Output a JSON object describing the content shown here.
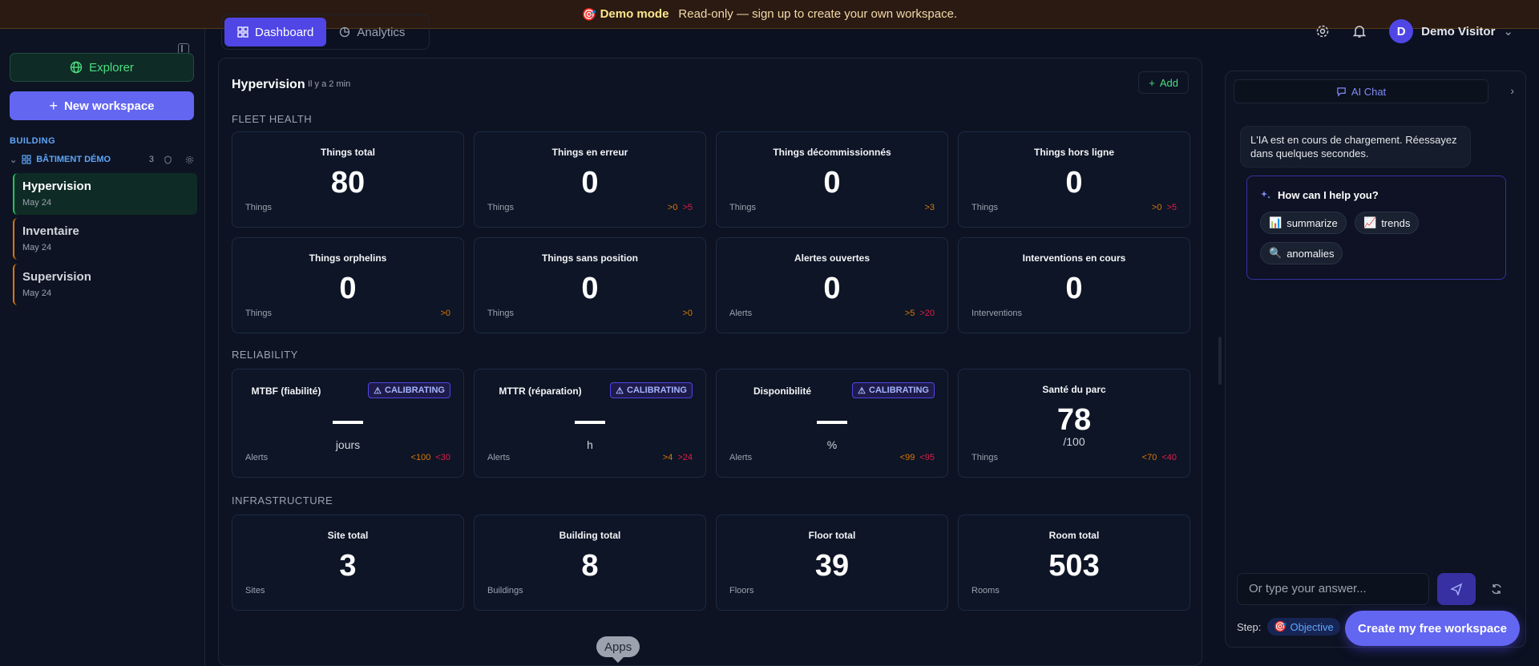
{
  "banner": {
    "icon": "🎯",
    "title": "Demo mode",
    "text": "Read-only — sign up to create your own workspace."
  },
  "sidebar": {
    "explorer_label": "Explorer",
    "new_workspace_label": "New workspace",
    "section_label": "BUILDING",
    "building": {
      "name": "BÂTIMENT DÉMO",
      "count": "3"
    },
    "workspaces": [
      {
        "name": "Hypervision",
        "date": "May 24",
        "active": true
      },
      {
        "name": "Inventaire",
        "date": "May 24"
      },
      {
        "name": "Supervision",
        "date": "May 24"
      }
    ]
  },
  "header": {
    "tabs": [
      {
        "label": "Dashboard"
      },
      {
        "label": "Analytics"
      }
    ],
    "user": {
      "initial": "D",
      "name": "Demo Visitor"
    }
  },
  "main": {
    "title": "Hypervision",
    "subtitle": "Il y a 2 min",
    "add_label": "Add",
    "fleet_label": "FLEET HEALTH",
    "reliability_label": "RELIABILITY",
    "infra_label": "INFRASTRUCTURE",
    "fleet": [
      {
        "title": "Things total",
        "value": "80",
        "unit": "Things",
        "warn": "",
        "err": ""
      },
      {
        "title": "Things en erreur",
        "value": "0",
        "unit": "Things",
        "warn": ">0",
        "err": ">5"
      },
      {
        "title": "Things décommissionnés",
        "value": "0",
        "unit": "Things",
        "warn": ">3",
        "err": ""
      },
      {
        "title": "Things hors ligne",
        "value": "0",
        "unit": "Things",
        "warn": ">0",
        "err": ">5"
      },
      {
        "title": "Things orphelins",
        "value": "0",
        "unit": "Things",
        "warn": ">0",
        "err": ""
      },
      {
        "title": "Things sans position",
        "value": "0",
        "unit": "Things",
        "warn": ">0",
        "err": ""
      },
      {
        "title": "Alertes ouvertes",
        "value": "0",
        "unit": "Alerts",
        "warn": ">5",
        "err": ">20"
      },
      {
        "title": "Interventions en cours",
        "value": "0",
        "unit": "Interventions",
        "warn": "",
        "err": ""
      }
    ],
    "reliability": [
      {
        "title": "MTBF (fiabilité)",
        "badge": "CALIBRATING",
        "unit_value": "jours",
        "unit": "Alerts",
        "warn": "<100",
        "err": "<30"
      },
      {
        "title": "MTTR (réparation)",
        "badge": "CALIBRATING",
        "unit_value": "h",
        "unit": "Alerts",
        "warn": ">4",
        "err": ">24"
      },
      {
        "title": "Disponibilité",
        "badge": "CALIBRATING",
        "unit_value": "%",
        "unit": "Alerts",
        "warn": "<99",
        "err": "<95"
      }
    ],
    "health": {
      "title": "Santé du parc",
      "value": "78",
      "sub": "/100",
      "unit": "Things",
      "warn": "<70",
      "err": "<40"
    },
    "infra": [
      {
        "title": "Site total",
        "value": "3",
        "unit": "Sites"
      },
      {
        "title": "Building total",
        "value": "8",
        "unit": "Buildings"
      },
      {
        "title": "Floor total",
        "value": "39",
        "unit": "Floors"
      },
      {
        "title": "Room total",
        "value": "503",
        "unit": "Rooms"
      }
    ]
  },
  "chat": {
    "tab_label": "AI Chat",
    "message": "L'IA est en cours de chargement. Réessayez dans quelques secondes.",
    "help_title": "How can I help you?",
    "chips": [
      {
        "icon": "📊",
        "label": "summarize"
      },
      {
        "icon": "📈",
        "label": "trends"
      },
      {
        "icon": "🔍",
        "label": "anomalies"
      }
    ],
    "input_placeholder": "Or type your answer...",
    "step_label": "Step:",
    "step_icon": "🎯",
    "step_value": "Objective"
  },
  "cta_label": "Create my free workspace",
  "apps_label": "Apps"
}
